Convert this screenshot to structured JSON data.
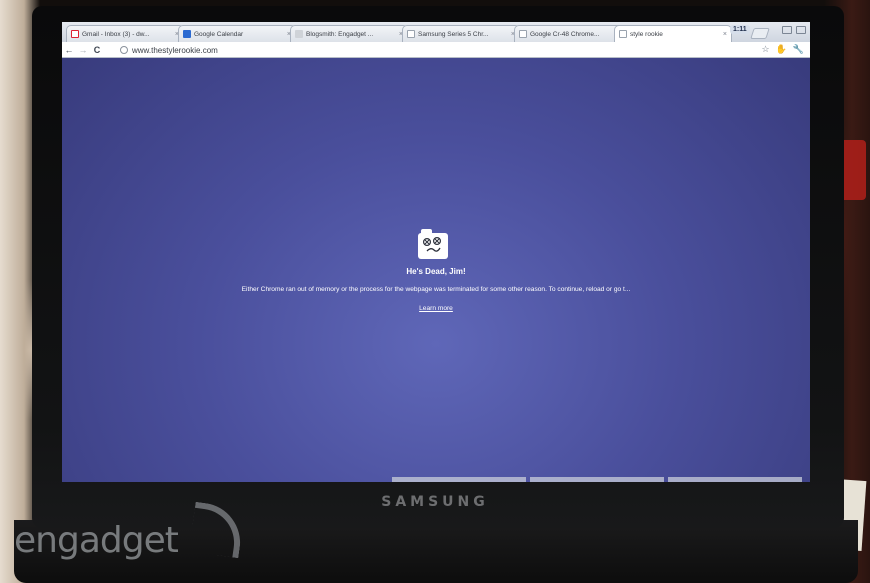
{
  "tabs": [
    {
      "label": "Gmail - Inbox (3) - dw...",
      "icon": "gmail-icon"
    },
    {
      "label": "Google Calendar",
      "icon": "calendar-icon"
    },
    {
      "label": "Blogsmith: Engadget ...",
      "icon": "blogsmith-icon"
    },
    {
      "label": "Samsung Series 5 Chr...",
      "icon": "page-icon"
    },
    {
      "label": "Google Cr-48 Chrome...",
      "icon": "page-icon"
    },
    {
      "label": "style rookie",
      "icon": "page-icon"
    }
  ],
  "tab_close": "×",
  "clock": "1:11",
  "toolbar": {
    "back": "←",
    "forward": "→",
    "reload": "C",
    "url": "www.thestylerookie.com",
    "star": "☆",
    "extension": "✋",
    "wrench": "🔧"
  },
  "sad_tab": {
    "title": "He's Dead, Jim!",
    "message": "Either Chrome ran out of memory or the process for the webpage was terminated for some other reason.  To continue, reload or go t...",
    "link": "Learn more"
  },
  "laptop_brand": "SAMSUNG",
  "watermark": "engadget"
}
